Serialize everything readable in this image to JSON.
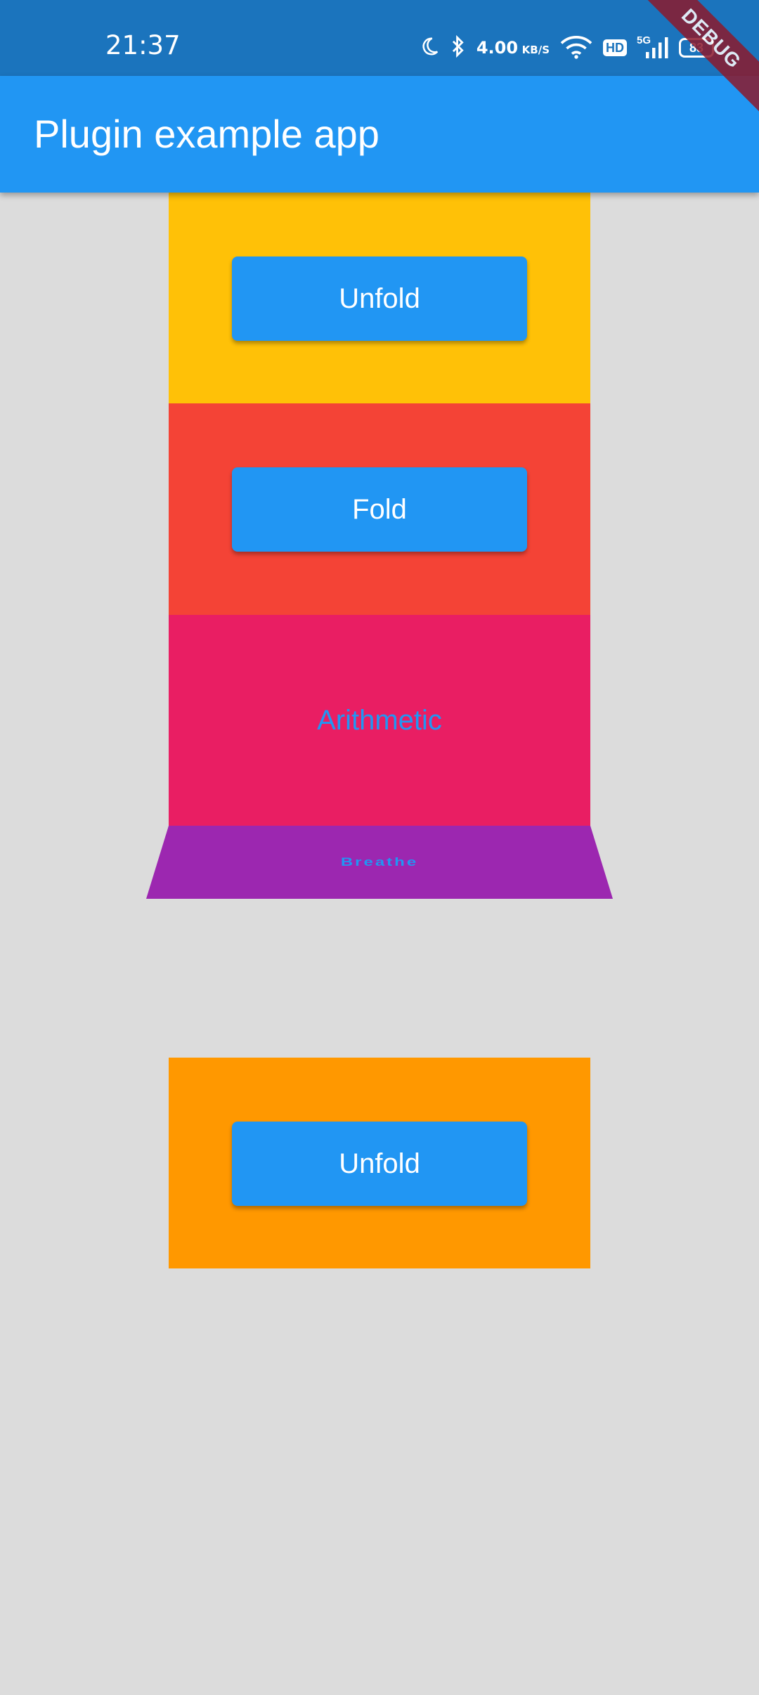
{
  "status_bar": {
    "time": "21:37",
    "net_speed_value": "4.00",
    "net_speed_unit": "KB/S",
    "hd_label": "HD",
    "signal_label": "5G",
    "battery_level": "83"
  },
  "debug_banner": "DEBUG",
  "app_bar": {
    "title": "Plugin example app"
  },
  "panels": {
    "first_button": "Unfold",
    "second_button": "Fold",
    "third_text": "Arithmetic",
    "fourth_text": "Breathe",
    "bottom_button": "Unfold"
  },
  "colors": {
    "status_bar": "#1b74bd",
    "app_bar": "#2196f3",
    "background": "#dcdcdc",
    "panel_yellow": "#ffc107",
    "panel_red": "#f44336",
    "panel_pink": "#e91e63",
    "panel_purple": "#9c27b0",
    "panel_orange": "#ff9800",
    "button": "#2196f3"
  }
}
